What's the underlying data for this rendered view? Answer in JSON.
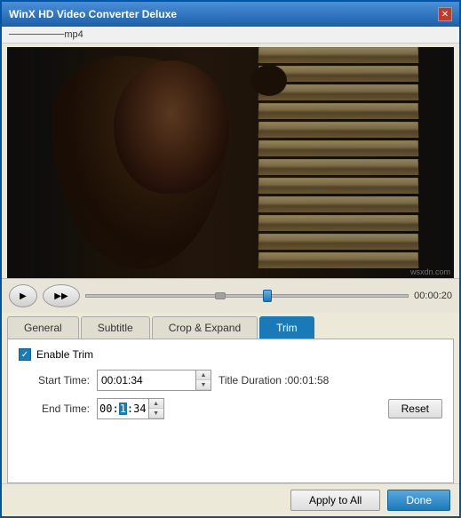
{
  "window": {
    "title": "WinX HD Video Converter Deluxe",
    "close_label": "✕"
  },
  "file_bar": {
    "filename": "mp4"
  },
  "controls": {
    "play_icon": "▶",
    "fastfwd_icon": "▶▶",
    "time": "00:00:20"
  },
  "tabs": [
    {
      "label": "General",
      "id": "general"
    },
    {
      "label": "Subtitle",
      "id": "subtitle"
    },
    {
      "label": "Crop & Expand",
      "id": "crop"
    },
    {
      "label": "Trim",
      "id": "trim"
    }
  ],
  "trim": {
    "enable_label": "Enable Trim",
    "start_label": "Start Time:",
    "start_value": "00:01:34",
    "end_label": "End Time:",
    "end_value": "00:01:34",
    "end_highlight": "00:",
    "end_after_highlight": ":34",
    "end_middle": "1",
    "duration_label": "Title Duration :",
    "duration_value": "00:01:58",
    "reset_label": "Reset"
  },
  "footer": {
    "apply_label": "Apply to All",
    "done_label": "Done"
  },
  "watermark": "wsxdn.com"
}
